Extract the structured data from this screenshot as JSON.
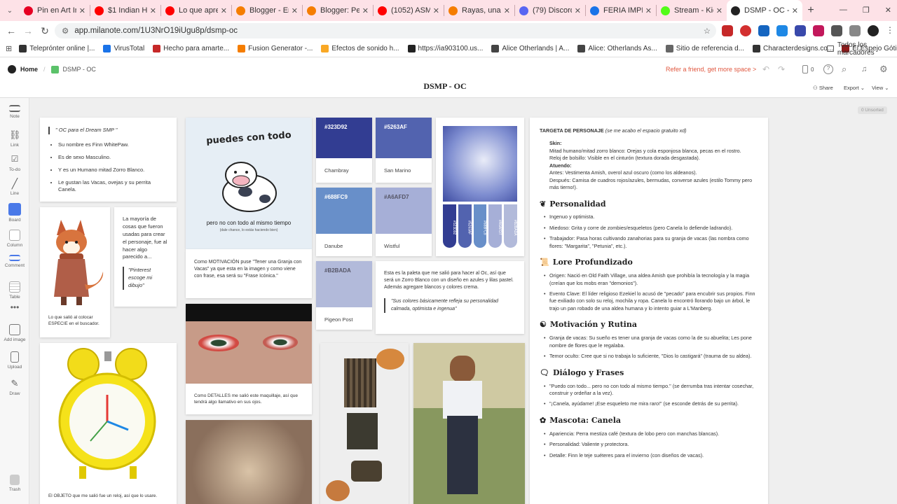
{
  "browser": {
    "tabs": [
      {
        "title": "Pin en Art Insp",
        "color": "#e60023"
      },
      {
        "title": "$1 Indian Head",
        "color": "#ff0000"
      },
      {
        "title": "Lo que aprendi",
        "color": "#ff0000"
      },
      {
        "title": "Blogger - Entra",
        "color": "#f57d00"
      },
      {
        "title": "Blogger: Perfil",
        "color": "#f57d00"
      },
      {
        "title": "(1052) ASMR L",
        "color": "#ff0000"
      },
      {
        "title": "Rayas, una cel",
        "color": "#f57d00"
      },
      {
        "title": "(79) Discord | C",
        "color": "#5865f2"
      },
      {
        "title": "FERIA IMPRIM",
        "color": "#1a73e8"
      },
      {
        "title": "Stream - Kick D",
        "color": "#53fc18"
      },
      {
        "title": "DSMP - OC - M",
        "color": "#222222"
      }
    ],
    "url": "app.milanote.com/1U3NrO19iUgu8p/dsmp-oc",
    "bookmarks": [
      "Teleprónter online |...",
      "VirusTotal",
      "Hecho para amarte...",
      "Fusion Generator -...",
      "Efectos de sonido h...",
      "https://ia903100.us...",
      "Alice Otherlands | A...",
      "Alice: Otherlands As...",
      "Sitio de referencia d...",
      "Characterdesigns.co...",
      "El Espejo Gótico: De..."
    ],
    "bookmarks_folder": "Todos los marcadores"
  },
  "app": {
    "home": "Home",
    "breadcrumb": "DSMP - OC",
    "refer": "Refer a friend, get more space >",
    "counter": "0",
    "board_title": "DSMP - OC",
    "share": "Share",
    "export": "Export",
    "view": "View",
    "unsorted": "0 Unsorted"
  },
  "tools": [
    "Note",
    "Link",
    "To-do",
    "Line",
    "Board",
    "Column",
    "Comment",
    "Table",
    "Add image",
    "Upload",
    "Draw"
  ],
  "trash": "Trash",
  "note1": {
    "title": "\" OC para el Dream SMP \"",
    "items": [
      "Su nombre es Finn WhitePaw.",
      "Es de sexo Masculino.",
      "Y es un Humano mitad Zorro Blanco.",
      "Le gustan las Vacas, ovejas y su perrita Canela."
    ]
  },
  "fox_caption": "Lo que salió al colocar ESPECIE en el buscador.",
  "note2": {
    "text": "La mayoría de cosas que fueron usadas para crear el personaje, fue al hacer algo parecido a...",
    "quote": "\"Pinterest escoge mi dibujo\""
  },
  "clock_caption": "El OBJETO que me salió fue un reloj, así que lo usare.",
  "cow": {
    "headline": "puedes con todo",
    "subline": "pero no con todo al mismo tiempo",
    "small": "(dale chance, lo estás haciendo bien)"
  },
  "motivation": "Como MOTIVACIÓN puse \"Tener una Granja con Vacas\" ya que esta en la imagen y como viene con frase, esa será su \"Frase Icónica.\"",
  "details": "Como DETALLES me salió este maquillaje, así que tendrá algo llamativo en sus ojos.",
  "swatches": [
    {
      "hex": "#323D92",
      "name": "Chambray"
    },
    {
      "hex": "#5263AF",
      "name": "San Marino"
    },
    {
      "hex": "#688FC9",
      "name": "Danube"
    },
    {
      "hex": "#A6AFD7",
      "name": "Wistful"
    },
    {
      "hex": "#B2BADA",
      "name": "Pigeon Post"
    }
  ],
  "strip_codes": [
    "#323D92",
    "#5263AF",
    "#688FC9",
    "#A6AFD7",
    "#B2BADA"
  ],
  "palette_note": {
    "text": "Esta es la paleta que me salió para hacer al Oc, así que será un Zorro Blanco con un diseño en azules y lilas pastel. Además agregare blancos y colores crema.",
    "quote": "\"Sus colores básicamente refleja su personalidad calmada, optimista e ingenua\""
  },
  "sheet": {
    "title": "TARGETA DE PERSONAJE",
    "title_note": "(se me acabo el espacio gratuito xd)",
    "skin": [
      "Skin:",
      "Mitad humano/mitad zorro blanco: Orejas y cola esponjosa blanca, pecas en el rostro.",
      "Reloj de bolsillo: Visible en el cinturón (textura dorada desgastada).",
      "Atuendo:",
      "Antes: Vestimenta Amish, overol azul oscuro (como los aldeanos).",
      "Después: Camisa de cuadros rojos/azules, bermudas, converse azules (estilo Tommy pero más tierno!)."
    ],
    "sections": [
      {
        "heading": "Personalidad",
        "items": [
          "Ingenuo y optimista.",
          "Miedoso: Grita y corre de zombies/esqueletos (pero Canela lo defiende ladrando).",
          "Trabajador: Pasa horas cultivando zanahorias para su granja de vacas (las nombra como flores: \"Margarita\", \"Petunia\", etc.)."
        ]
      },
      {
        "heading": "Lore Profundizado",
        "items": [
          "Origen: Nació en Old Faith Village, una aldea Amish que prohibía la tecnología y la magia (creían que los mobs eran \"demonios\").",
          "Evento Clave: El líder religioso Ezekiel lo acusó de \"pecado\" para encubrir sus propios. Finn fue exiliado con solo su reloj, mochila y ropa. Canela lo encontró llorando bajo un árbol, le trajo un pan robado de una aldea humana y lo intento guiar a L'Manberg."
        ]
      },
      {
        "heading": "Motivación y Rutina",
        "items": [
          "Granja de vacas: Su sueño es tener una granja de vacas como la de su abuelita; Les pone nombre de flores que le regalaba.",
          "Temor oculto: Cree que si no trabaja lo suficiente, \"Dios lo castigará\" (trauma de su aldea)."
        ]
      },
      {
        "heading": "Diálogo y Frases",
        "items": [
          "\"Puedo con todo... pero no con todo al mismo tiempo.\" (se derrumba tras intentar cosechar, construir y ordeñar a la vez).",
          "\"¡Canela, ayúdame! ¡Ese esqueleto me mira raro!\" (se esconde detrás de su perrita)."
        ]
      },
      {
        "heading": "Mascota: Canela",
        "items": [
          "Apariencia: Perra mestiza café (textura de lobo pero con manchas blancas).",
          "Personalidad: Valiente y protectora.",
          "Detalle: Finn le teje suéteres para el invierno (con diseños de vacas)."
        ]
      }
    ]
  }
}
